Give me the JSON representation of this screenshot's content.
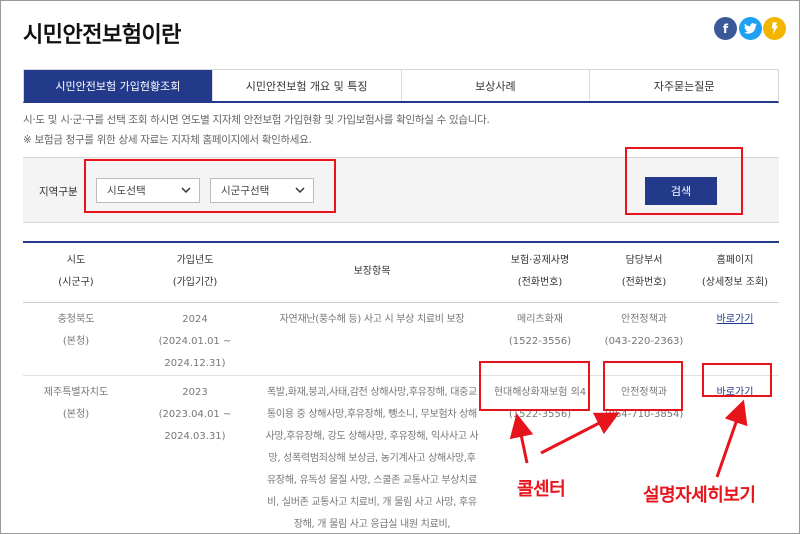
{
  "page": {
    "title": "시민안전보험이란"
  },
  "social": [
    {
      "icon": "facebook-icon",
      "glyph": "f",
      "color": "#3b5998"
    },
    {
      "icon": "twitter-icon",
      "glyph": "",
      "color": "#1da1f2"
    },
    {
      "icon": "kakaostory-icon",
      "glyph": "",
      "color": "#f2b600"
    }
  ],
  "tabs": [
    {
      "label": "시민안전보험 가입현황조회",
      "active": true
    },
    {
      "label": "시민안전보험 개요 및 특징",
      "active": false
    },
    {
      "label": "보상사례",
      "active": false
    },
    {
      "label": "자주묻는질문",
      "active": false
    }
  ],
  "notices": [
    "시·도 및 시·군·구를 선택 조회 하시면 연도별 지자체 안전보험 가입현황 및 가입보험사를 확인하실 수 있습니다.",
    "※ 보험금 청구를 위한 상세 자료는 지자체 홈페이지에서 확인하세요."
  ],
  "search": {
    "region_label": "지역구분",
    "sido_select": "시도선택",
    "sigungu_select": "시군구선택",
    "button": "검색"
  },
  "table": {
    "headers": [
      [
        "시도",
        "(시군구)"
      ],
      [
        "가입년도",
        "(가입기간)"
      ],
      [
        "보장항목",
        ""
      ],
      [
        "보험·공제사명",
        "(전화번호)"
      ],
      [
        "담당부서",
        "(전화번호)"
      ],
      [
        "홈페이지",
        "(상세정보 조회)"
      ]
    ],
    "rows": [
      {
        "region": "충청북도",
        "region_sub": "(본청)",
        "year": "2024",
        "period": "(2024.01.01 ~ 2024.12.31)",
        "coverage": "자연재난(풍수해 등) 사고 시 부상 치료비 보장",
        "insurer": "메리츠화재",
        "insurer_phone": "(1522-3556)",
        "dept": "안전정책과",
        "dept_phone": "(043-220-2363)",
        "homepage": "바로가기"
      },
      {
        "region": "제주특별자치도",
        "region_sub": "(본청)",
        "year": "2023",
        "period": "(2023.04.01 ~ 2024.03.31)",
        "coverage": "폭발,화재,붕괴,사태,감전 상해사망,후유장해, 대중교통이용 중 상해사망,후유장해, 뺑소니, 무보험차 상해사망,후유장해, 강도 상해사망, 후유장해, 익사사고 사망, 성폭력범죄상해 보상금, 농기계사고 상해사망,후유장해, 유독성 물질 사망, 스쿨존 교통사고 부상치료비, 실버존 교통사고 치료비, 개 물림 사고 사망, 후유장해, 개 물림 사고 응급실 내원 치료비,",
        "insurer": "현대해상화재보험 외4",
        "insurer_phone": "(1522-3556)",
        "dept": "안전정책과",
        "dept_phone": "(064-710-3854)",
        "homepage": "바로가기"
      }
    ]
  },
  "annotations": {
    "call_center": "콜센터",
    "detail_view": "설명자세히보기",
    "color": "#e8141b"
  },
  "colors": {
    "brand": "#233a8b",
    "highlight": "#e8141b"
  }
}
